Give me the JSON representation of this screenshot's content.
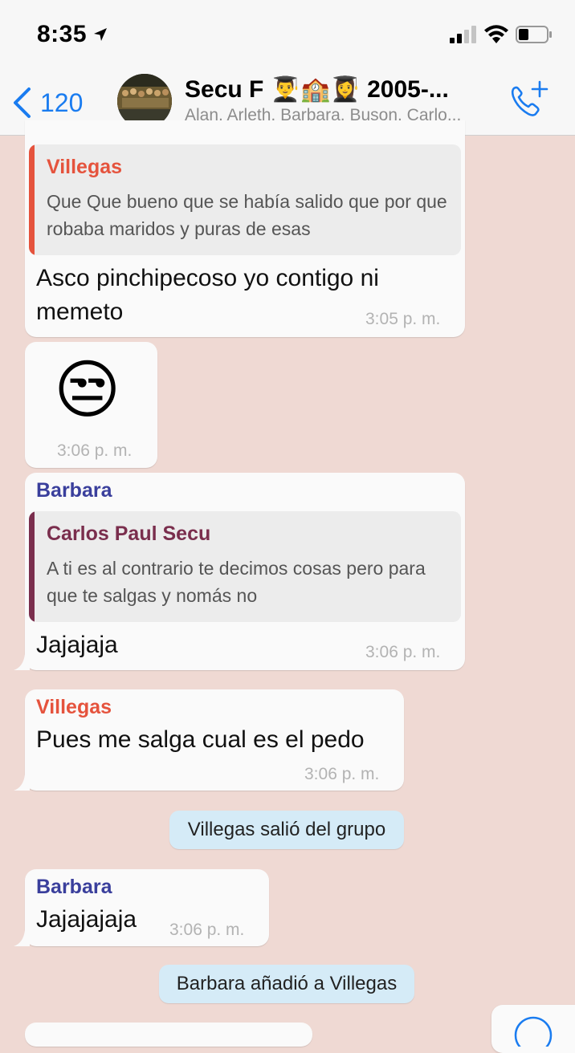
{
  "status_bar": {
    "time": "8:35"
  },
  "nav": {
    "back_count": "120",
    "title": "Secu F   👨‍🎓🏫👩‍🎓  2005-...",
    "subtitle": "Alan, Arleth, Barbara, Buson, Carlo...",
    "accent_color": "#1a7cf0"
  },
  "messages": [
    {
      "quote_sender": "Villegas",
      "quote_text": "Que Que bueno que se había salido que por que robaba maridos y puras de esas",
      "text": "Asco pinchipecoso yo contigo ni memeto",
      "time": "3:05 p. m."
    },
    {
      "emoji": "😒",
      "time": "3:06 p. m."
    },
    {
      "sender": "Barbara",
      "quote_sender": "Carlos Paul Secu",
      "quote_text": "A ti es al contrario te decimos cosas pero para que te salgas y nomás no",
      "text": "Jajajaja",
      "time": "3:06 p. m."
    },
    {
      "sender": "Villegas",
      "text": "Pues me salga cual es el pedo",
      "time": "3:06 p. m."
    },
    {
      "sender": "Barbara",
      "text": "Jajajajaja",
      "time": "3:06 p. m."
    }
  ],
  "system_messages": [
    "Villegas salió del grupo",
    "Barbara añadió a Villegas"
  ],
  "colors": {
    "villegas": "#e5533d",
    "barbara": "#3a3f9c",
    "carlos": "#7a2e4d",
    "background": "#efd9d3"
  }
}
